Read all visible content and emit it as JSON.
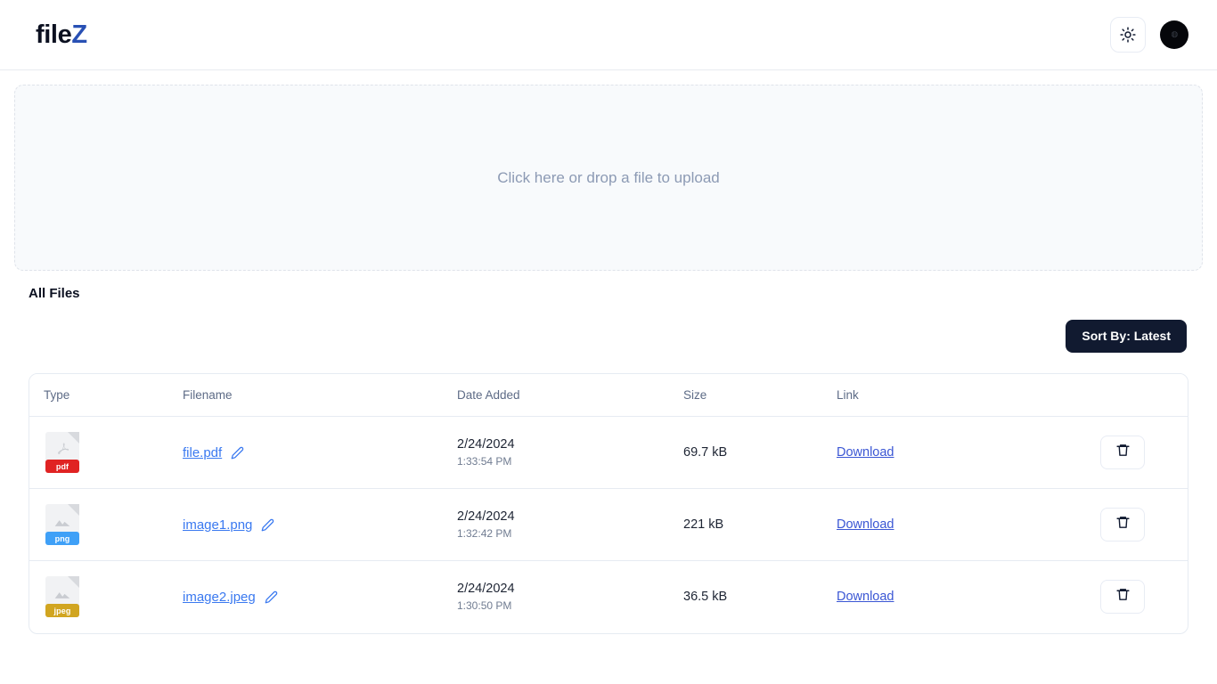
{
  "app": {
    "logo_primary": "file",
    "logo_accent": "Z",
    "theme_toggle_icon": "sun-icon",
    "avatar_glyph": "user-avatar"
  },
  "upload": {
    "prompt": "Click here or drop a file to upload"
  },
  "files_section": {
    "title": "All Files",
    "sort_label": "Sort By: Latest"
  },
  "table": {
    "headers": [
      "Type",
      "Filename",
      "Date Added",
      "Size",
      "Link",
      ""
    ],
    "rows": [
      {
        "type_label": "pdf",
        "type_icon": "pdf-file-icon",
        "badge_color": "#e02323",
        "filename": "file.pdf",
        "edit_icon": "pencil-icon",
        "date": "2/24/2024",
        "time": "1:33:54 PM",
        "size": "69.7 kB",
        "link_label": "Download",
        "delete_icon": "trash-icon"
      },
      {
        "type_label": "png",
        "type_icon": "image-file-icon",
        "badge_color": "#3fa0f7",
        "filename": "image1.png",
        "edit_icon": "pencil-icon",
        "date": "2/24/2024",
        "time": "1:32:42 PM",
        "size": "221 kB",
        "link_label": "Download",
        "delete_icon": "trash-icon"
      },
      {
        "type_label": "jpeg",
        "type_icon": "image-file-icon",
        "badge_color": "#d1a520",
        "filename": "image2.jpeg",
        "edit_icon": "pencil-icon",
        "date": "2/24/2024",
        "time": "1:30:50 PM",
        "size": "36.5 kB",
        "link_label": "Download",
        "delete_icon": "trash-icon"
      }
    ]
  },
  "colors": {
    "accent_blue": "#2850b4",
    "link_blue": "#3a79f0",
    "button_dark": "#111a30",
    "muted_text": "#8c9ab4"
  }
}
